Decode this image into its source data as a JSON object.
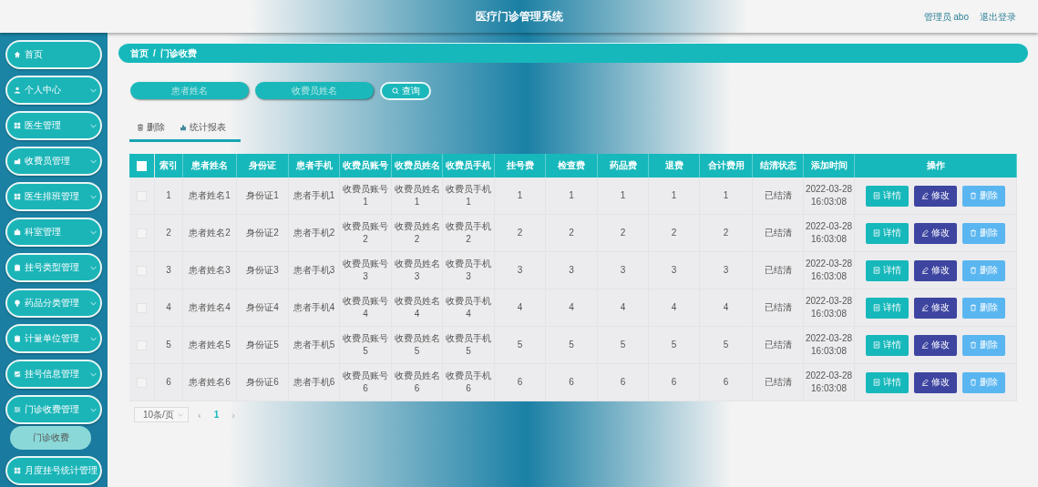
{
  "header": {
    "title": "医疗门诊管理系统",
    "user": "管理员 abo",
    "logout": "退出登录"
  },
  "sidebar": {
    "items": [
      {
        "label": "首页",
        "kind": "link"
      },
      {
        "label": "个人中心",
        "kind": "menu"
      },
      {
        "label": "医生管理",
        "kind": "menu"
      },
      {
        "label": "收费员管理",
        "kind": "menu"
      },
      {
        "label": "医生排班管理",
        "kind": "menu"
      },
      {
        "label": "科室管理",
        "kind": "menu"
      },
      {
        "label": "挂号类型管理",
        "kind": "menu"
      },
      {
        "label": "药品分类管理",
        "kind": "menu"
      },
      {
        "label": "计量单位管理",
        "kind": "menu"
      },
      {
        "label": "挂号信息管理",
        "kind": "menu"
      },
      {
        "label": "门诊收费管理",
        "kind": "menu",
        "children": [
          {
            "label": "门诊收费",
            "selected": true
          }
        ]
      },
      {
        "label": "月度挂号统计管理",
        "kind": "link"
      }
    ]
  },
  "breadcrumb": [
    "首页",
    "/",
    "门诊收费"
  ],
  "search": {
    "fields": [
      {
        "placeholder": "患者姓名"
      },
      {
        "placeholder": "收费员姓名"
      }
    ],
    "button": "查询"
  },
  "toolbar": [
    {
      "kind": "delete",
      "label": "删除"
    },
    {
      "kind": "report",
      "label": "统计报表"
    }
  ],
  "table": {
    "select_all": {
      "checked": false
    },
    "columns": [
      "索引",
      "患者姓名",
      "身份证",
      "患者手机",
      "收费员账号",
      "收费员姓名",
      "收费员手机",
      "挂号费",
      "检查费",
      "药品费",
      "退费",
      "合计费用",
      "结清状态",
      "添加时间",
      "操作"
    ],
    "rows": [
      {
        "checked": false,
        "cells": [
          "1",
          "患者姓名1",
          "身份证1",
          "患者手机1",
          "收费员账号1",
          "收费员姓名1",
          "收费员手机1",
          "1",
          "1",
          "1",
          "1",
          "1",
          "已结清",
          "2022-03-28 16:03:08"
        ],
        "actions": [
          {
            "kind": "detail",
            "label": "详情"
          },
          {
            "kind": "edit",
            "label": "修改"
          },
          {
            "kind": "delete",
            "label": "删除"
          }
        ]
      },
      {
        "checked": false,
        "cells": [
          "2",
          "患者姓名2",
          "身份证2",
          "患者手机2",
          "收费员账号2",
          "收费员姓名2",
          "收费员手机2",
          "2",
          "2",
          "2",
          "2",
          "2",
          "已结清",
          "2022-03-28 16:03:08"
        ],
        "actions": [
          {
            "kind": "detail",
            "label": "详情"
          },
          {
            "kind": "edit",
            "label": "修改"
          },
          {
            "kind": "delete",
            "label": "删除"
          }
        ]
      },
      {
        "checked": false,
        "cells": [
          "3",
          "患者姓名3",
          "身份证3",
          "患者手机3",
          "收费员账号3",
          "收费员姓名3",
          "收费员手机3",
          "3",
          "3",
          "3",
          "3",
          "3",
          "已结清",
          "2022-03-28 16:03:08"
        ],
        "actions": [
          {
            "kind": "detail",
            "label": "详情"
          },
          {
            "kind": "edit",
            "label": "修改"
          },
          {
            "kind": "delete",
            "label": "删除"
          }
        ]
      },
      {
        "checked": false,
        "cells": [
          "4",
          "患者姓名4",
          "身份证4",
          "患者手机4",
          "收费员账号4",
          "收费员姓名4",
          "收费员手机4",
          "4",
          "4",
          "4",
          "4",
          "4",
          "已结清",
          "2022-03-28 16:03:08"
        ],
        "actions": [
          {
            "kind": "detail",
            "label": "详情"
          },
          {
            "kind": "edit",
            "label": "修改"
          },
          {
            "kind": "delete",
            "label": "删除"
          }
        ]
      },
      {
        "checked": false,
        "cells": [
          "5",
          "患者姓名5",
          "身份证5",
          "患者手机5",
          "收费员账号5",
          "收费员姓名5",
          "收费员手机5",
          "5",
          "5",
          "5",
          "5",
          "5",
          "已结清",
          "2022-03-28 16:03:08"
        ],
        "actions": [
          {
            "kind": "detail",
            "label": "详情"
          },
          {
            "kind": "edit",
            "label": "修改"
          },
          {
            "kind": "delete",
            "label": "删除"
          }
        ]
      },
      {
        "checked": false,
        "cells": [
          "6",
          "患者姓名6",
          "身份证6",
          "患者手机6",
          "收费员账号6",
          "收费员姓名6",
          "收费员手机6",
          "6",
          "6",
          "6",
          "6",
          "6",
          "已结清",
          "2022-03-28 16:03:08"
        ],
        "actions": [
          {
            "kind": "detail",
            "label": "详情"
          },
          {
            "kind": "edit",
            "label": "修改"
          },
          {
            "kind": "delete",
            "label": "删除"
          }
        ]
      }
    ]
  },
  "pagination": {
    "page_size": "10条/页",
    "prev": "‹",
    "pages": [
      {
        "label": "1",
        "selected": true
      }
    ],
    "next": "›"
  }
}
